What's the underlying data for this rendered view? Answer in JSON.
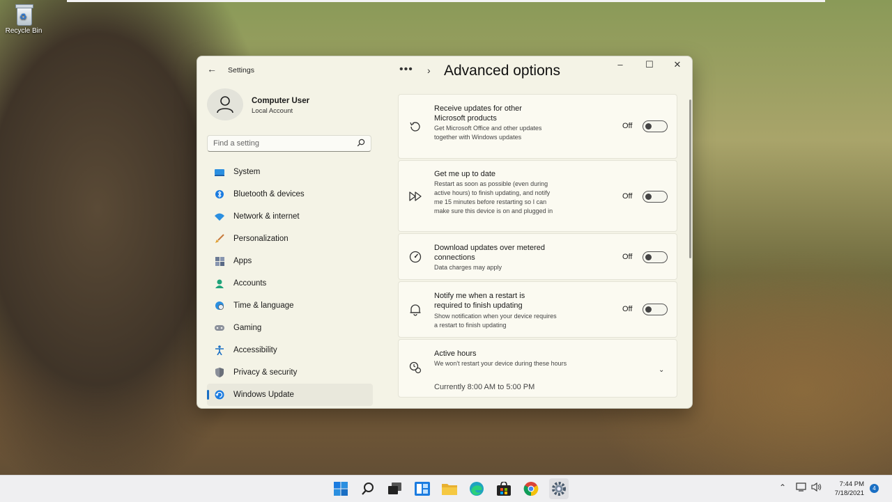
{
  "desktop": {
    "recycle_bin_label": "Recycle Bin"
  },
  "window": {
    "app_title": "Settings",
    "caption": {
      "minimize": "–",
      "maximize": "☐",
      "close": "✕"
    }
  },
  "profile": {
    "name": "Computer User",
    "account_type": "Local Account"
  },
  "search": {
    "placeholder": "Find a setting"
  },
  "nav": {
    "items": [
      {
        "label": "System",
        "icon": "monitor-icon"
      },
      {
        "label": "Bluetooth & devices",
        "icon": "bluetooth-icon"
      },
      {
        "label": "Network & internet",
        "icon": "wifi-icon"
      },
      {
        "label": "Personalization",
        "icon": "brush-icon"
      },
      {
        "label": "Apps",
        "icon": "apps-icon"
      },
      {
        "label": "Accounts",
        "icon": "person-icon"
      },
      {
        "label": "Time & language",
        "icon": "globe-clock-icon"
      },
      {
        "label": "Gaming",
        "icon": "gamepad-icon"
      },
      {
        "label": "Accessibility",
        "icon": "accessibility-icon"
      },
      {
        "label": "Privacy & security",
        "icon": "shield-icon"
      },
      {
        "label": "Windows Update",
        "icon": "update-icon",
        "active": true
      }
    ]
  },
  "header": {
    "breadcrumb_dots": "•••",
    "breadcrumb_sep": "›",
    "title": "Advanced options"
  },
  "settings": [
    {
      "title": "Receive updates for other Microsoft products",
      "description": "Get Microsoft Office and other updates together with Windows updates",
      "state": "Off",
      "icon": "history-icon"
    },
    {
      "title": "Get me up to date",
      "description": "Restart as soon as possible (even during active hours) to finish updating, and notify me 15 minutes before restarting so I can make sure this device is on and plugged in",
      "state": "Off",
      "icon": "fast-forward-icon"
    },
    {
      "title": "Download updates over metered connections",
      "description": "Data charges may apply",
      "state": "Off",
      "icon": "gauge-icon"
    },
    {
      "title": "Notify me when a restart is required to finish updating",
      "description": "Show notification when your device requires a restart to finish updating",
      "state": "Off",
      "icon": "bell-icon"
    }
  ],
  "active_hours": {
    "title": "Active hours",
    "description": "We won't restart your device during these hours",
    "current": "Currently 8:00 AM to 5:00 PM"
  },
  "taskbar": {
    "clock_time": "7:44 PM",
    "clock_date": "7/18/2021",
    "notification_count": "4"
  },
  "colors": {
    "accent": "#1a6fc4",
    "window_bg": "#f4f3e6",
    "card_bg": "#fbfaf1"
  }
}
